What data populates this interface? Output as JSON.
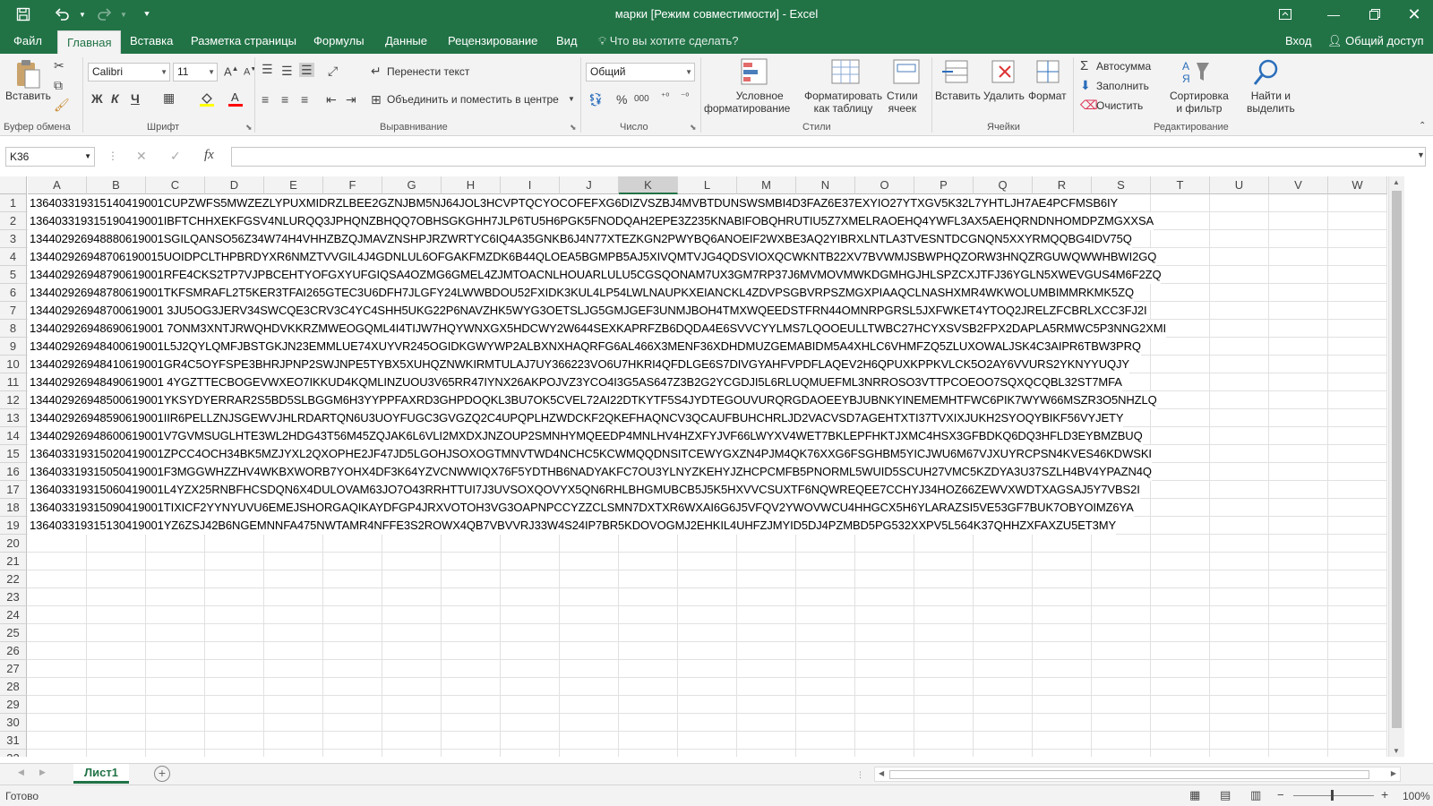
{
  "window": {
    "title": "марки  [Режим совместимости] - Excel",
    "login": "Вход",
    "share": "Общий доступ"
  },
  "tabs": [
    "Файл",
    "Главная",
    "Вставка",
    "Разметка страницы",
    "Формулы",
    "Данные",
    "Рецензирование",
    "Вид"
  ],
  "search_placeholder": "Что вы хотите сделать?",
  "ribbon": {
    "paste": "Вставить",
    "clipboard_group": "Буфер обмена",
    "font_name": "Calibri",
    "font_size": "11",
    "font_group": "Шрифт",
    "bold": "Ж",
    "italic": "К",
    "underline": "Ч",
    "wrap_text": "Перенести текст",
    "merge_center": "Объединить и поместить в центре",
    "alignment_group": "Выравнивание",
    "number_format": "Общий",
    "number_group": "Число",
    "cond_format_1": "Условное",
    "cond_format_2": "форматирование",
    "format_table_1": "Форматировать",
    "format_table_2": "как таблицу",
    "cell_styles_1": "Стили",
    "cell_styles_2": "ячеек",
    "styles_group": "Стили",
    "insert": "Вставить",
    "delete": "Удалить",
    "format": "Формат",
    "cells_group": "Ячейки",
    "autosum": "Автосумма",
    "fill": "Заполнить",
    "clear": "Очистить",
    "sort_1": "Сортировка",
    "sort_2": "и фильтр",
    "find_1": "Найти и",
    "find_2": "выделить",
    "editing_group": "Редактирование"
  },
  "formula_bar": {
    "name_box": "K36",
    "fx": "fx",
    "value": ""
  },
  "columns": [
    "A",
    "B",
    "C",
    "D",
    "E",
    "F",
    "G",
    "H",
    "I",
    "J",
    "K",
    "L",
    "M",
    "N",
    "O",
    "P",
    "Q",
    "R",
    "S",
    "T",
    "U",
    "V",
    "W"
  ],
  "selected_column": "K",
  "rows": [
    "136403319315140419001CUPZWFS5MWZEZLYPUXMIDRZLBEE2GZNJBM5NJ64JOL3HCVPTQCYOCOFEFXG6DIZVSZBJ4MVBTDUNSWSMBI4D3FAZ6E37EXYIO27YTXGV5K32L7YHTLJH7AE4PCFMSB6IY",
    "136403319315190419001IBFTCHHXEKFGSV4NLURQQ3JPHQNZBHQQ7OBHSGKGHH7JLP6TU5H6PGK5FNODQAH2EPE3Z235KNABIFOBQHRUTIU5Z7XMELRAOEHQ4YWFL3AX5AEHQRNDNHOMDPZMGXXSA",
    "134402926948880619001SGILQANSO56Z34W74H4VHHZBZQJMAVZNSHPJRZWRTYC6IQ4A35GNKB6J4N77XTEZKGN2PWYBQ6ANOEIF2WXBE3AQ2YIBRXLNTLA3TVESNTDCGNQN5XXYRMQQBG4IDV75Q",
    "134402926948706190015UOIDPCLTHPBRDYXR6NMZTVVGIL4J4GDNLUL6OFGAKFMZDK6B44QLOEA5BGMPB5AJ5XIVQMTVJG4QDSVIOXQCWKNTB22XV7BVWMJSBWPHQZORW3HNQZRGUWQWWHBWI2GQ",
    "134402926948790619001RFE4CKS2TP7VJPBCEHTYOFGXYUFGIQSA4OZMG6GMEL4ZJMTOACNLHOUARLULU5CGSQONAM7UX3GM7RP37J6MVMOVMWKDGMHGJHLSPZCXJTFJ36YGLN5XWEVGUS4M6F2ZQ",
    "134402926948780619001TKFSMRAFL2T5KER3TFAI265GTEC3U6DFH7JLGFY24LWWBDOU52FXIDK3KUL4LP54LWLNAUPKXEIANCKL4ZDVPSGBVRPSZMGXPIAAQCLNASHXMR4WKWOLUMBIMMRKMK5ZQ",
    "134402926948700619001 3JU5OG3JERV34SWCQE3CRV3C4YC4SHH5UKG22P6NAVZHK5WYG3OETSLJG5GMJGEF3UNMJBOH4TMXWQEEDSTFRN44OMNRPGRSL5JXFWKET4YTOQ2JRELZFCBRLXCC3FJ2I",
    "134402926948690619001 7ONM3XNTJRWQHDVKKRZMWEOGQML4I4TIJW7HQYWNXGX5HDCWY2W644SEXKAPRFZB6DQDA4E6SVVCYYLMS7LQOOEULLTWBC27HCYXSVSB2FPX2DAPLA5RMWC5P3NNG2XMI",
    "134402926948400619001L5J2QYLQMFJBSTGKJN23EMMLUE74XUYVR245OGIDKGWYWP2ALBXNXHAQRFG6AL466X3MENF36XDHDMUZGEMABIDM5A4XHLC6VHMFZQ5ZLUXOWALJSK4C3AIPR6TBW3PRQ",
    "134402926948410619001GR4C5OYFSPE3BHRJPNP2SWJNPE5TYBX5XUHQZNWKIRMTULAJ7UY366223VO6U7HKRI4QFDLGE6S7DIVGYAHFVPDFLAQEV2H6QPUXKPPKVLCK5O2AY6VVURS2YKNYYUQJY",
    "134402926948490619001 4YGZTTECBOGEVWXEO7IKKUD4KQMLINZUOU3V65RR47IYNX26AKPOJVZ3YCO4I3G5AS647Z3B2G2YCGDJI5L6RLUQMUEFML3NRROSO3VTTPCOEOO7SQXQCQBL32ST7MFA",
    "134402926948500619001YKSYDYERRAR2S5BD5SLBGGM6H3YYPPFAXRD3GHPDOQKL3BU7OK5CVEL72AI22DTKYTF5S4JYDTEGOUVURQRGDAOEEYBJUBNKYINEMEMHTFWC6PIK7WYW66MSZR3O5NHZLQ",
    "134402926948590619001IIR6PELLZNJSGEWVJHLRDARTQN6U3UOYFUGC3GVGZQ2C4UPQPLHZWDCKF2QKEFHAQNCV3QCAUFBUHCHRLJD2VACVSD7AGEHTXTI37TVXIXJUKH2SYOQYBIKF56VYJETY",
    "134402926948600619001V7GVMSUGLHTE3WL2HDG43T56M45ZQJAK6L6VLI2MXDXJNZOUP2SMNHYMQEEDP4MNLHV4HZXFYJVF66LWYXV4WET7BKLEPFHKTJXMC4HSX3GFBDKQ6DQ3HFLD3EYBMZBUQ",
    "136403319315020419001ZPCC4OCH34BK5MZJYXL2QXOPHE2JF47JD5LGOHJSOXOGTMNVTWD4NCHC5KCWMQQDNSITCEWYGXZN4PJM4QK76XXG6FSGHBM5YICJWU6M67VJXUYRCPSN4KVES46KDWSKI",
    "136403319315050419001F3MGGWHZZHV4WKBXWORB7YOHX4DF3K64YZVCNWWIQX76F5YDTHB6NADYAKFC7OU3YLNYZKEHYJZHCPCMFB5PNORML5WUID5SCUH27VMC5KZDYA3U37SZLH4BV4YPAZN4Q",
    "136403319315060419001L4YZX25RNBFHCSDQN6X4DULOVAM63JO7O43RRHTTUI7J3UVSOXQOVYX5QN6RHLBHGMUBCB5J5K5HXVVCSUXTF6NQWREQEE7CCHYJ34HOZ66ZEWVXWDTXAGSAJ5Y7VBS2I",
    "136403319315090419001TIXICF2YYNYUVU6EMEJSHORGAQIKAYDFGP4JRXVOTOH3VG3OAPNPCCYZZCLSMN7DXTXR6WXAI6G6J5VFQV2YWOVWCU4HHGCX5H6YLARAZSI5VE53GF7BUK7OBYOIMZ6YA",
    "136403319315130419001YZ6ZSJ42B6NGEMNNFA475NWTAMR4NFFE3S2ROWX4QB7VBVVRJ33W4S24IP7BR5KDOVOGMJ2EHKIL4UHFZJMYID5DJ4PZMBD5PG532XXPV5L564K37QHHZXFAXZU5ET3MY"
  ],
  "row_count": 32,
  "sheet_tab": "Лист1",
  "status": {
    "ready": "Готово",
    "zoom": "100%"
  }
}
